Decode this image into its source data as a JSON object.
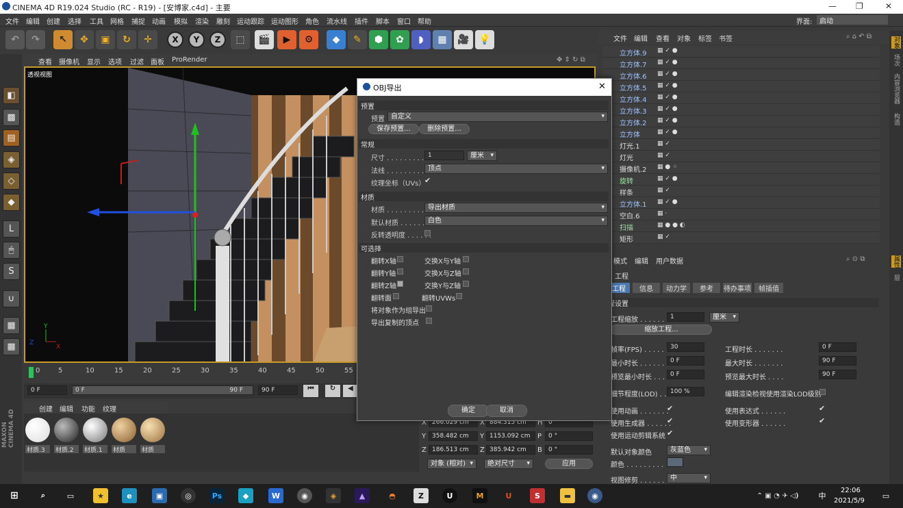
{
  "window": {
    "title": "CINEMA 4D R19.024 Studio (RC - R19) - [安博家.c4d] - 主要",
    "minimize": "—",
    "maximize": "❐",
    "close": "✕"
  },
  "menu": [
    "文件",
    "编辑",
    "创建",
    "选择",
    "工具",
    "网格",
    "捕捉",
    "动画",
    "模拟",
    "渲染",
    "雕刻",
    "运动跟踪",
    "运动图形",
    "角色",
    "流水线",
    "插件",
    "脚本",
    "窗口",
    "帮助"
  ],
  "layout": {
    "label": "界面:",
    "value": "启动"
  },
  "viewport": {
    "menu": [
      "查看",
      "摄像机",
      "显示",
      "选项",
      "过滤",
      "面板",
      "ProRender"
    ],
    "label": "透视视图"
  },
  "timeline": {
    "ticks": [
      "0",
      "5",
      "10",
      "15",
      "20",
      "25",
      "30",
      "35",
      "40",
      "45",
      "50",
      "55"
    ],
    "start": "0 F",
    "range_start": "0 F",
    "range_end": "90 F",
    "end": "90 F"
  },
  "materials": {
    "menu": [
      "创建",
      "编辑",
      "功能",
      "纹理"
    ],
    "items": [
      "材质.3",
      "材质.2",
      "材质.1",
      "材质",
      "材质"
    ]
  },
  "coords": {
    "x_pos": "266.029 cm",
    "y_pos": "358.482 cm",
    "z_pos": "186.513 cm",
    "x_size": "884.315 cm",
    "y_size": "1153.092 cm",
    "z_size": "385.942 cm",
    "h": "0 °",
    "p": "0 °",
    "b": "0 °",
    "mode": "对象 (相对)",
    "size_mode": "绝对尺寸",
    "apply": "应用"
  },
  "objects": {
    "menu": [
      "文件",
      "编辑",
      "查看",
      "对象",
      "标签",
      "书签"
    ],
    "rows": [
      "立方体.9",
      "立方体.7",
      "立方体.6",
      "立方体.5",
      "立方体.4",
      "立方体.3",
      "立方体.2",
      "立方体",
      "灯光.1",
      "灯光",
      "摄像机.2",
      "旋转",
      "样条",
      "立方体.1",
      "空白.6",
      "扫描",
      "矩形"
    ]
  },
  "attributes": {
    "menu": [
      "模式",
      "编辑",
      "用户数据"
    ],
    "title": "工程",
    "tabs": [
      "工程设置",
      "信息",
      "动力学",
      "参考",
      "待办事项",
      "帧插值"
    ],
    "section": "工程设置",
    "scale_label": "工程缩放 . . . . . . .",
    "scale_value": "1",
    "scale_unit": "厘米",
    "scale_btn": "缩放工程...",
    "fps_label": "帧率(FPS) . . . . . . .",
    "fps": "30",
    "time_label": "工程时长 . . . . . . .",
    "time": "0 F",
    "min_label": "最小时长 . . . . . . .",
    "min": "0 F",
    "max_label": "最大时长 . . . . . . .",
    "max": "90 F",
    "pmin_label": "预览最小时长 . . . .",
    "pmin": "0 F",
    "pmax_label": "预览最大时长 . . . .",
    "pmax": "90 F",
    "lod_label": "细节程度(LOD) . . . .",
    "lod": "100 %",
    "lod_render": "编辑渲染检视使用渲染LOD级别",
    "use_anim": "使用动画 . . . . . . .",
    "use_expr": "使用表达式 . . . . . .",
    "use_gen": "使用生成器 . . . . . .",
    "use_deform": "使用变形器 . . . . . .",
    "use_mograph": "使用运动剪辑系统",
    "obj_color_label": "默认对象颜色",
    "obj_color": "灰蓝色",
    "color_label": "颜色 . . . . . . . . .",
    "view_clip": "视图修剪 . . . . . . .",
    "view_clip_val": "中"
  },
  "dialog": {
    "title": "OBJ导出",
    "close": "✕",
    "sec_preset": "预置",
    "preset_label": "预置",
    "preset_value": "自定义",
    "save_preset": "保存预置...",
    "delete_preset": "删除预置...",
    "sec_general": "常规",
    "size_label": "尺寸 . . . . . . . . .",
    "size_value": "1",
    "size_unit": "厘米",
    "normal_label": "法线 . . . . . . . . .",
    "normal_value": "顶点",
    "uv_label": "纹理坐标（UVs）",
    "sec_material": "材质",
    "mat_label": "材质 . . . . . . . . .",
    "mat_value": "导出材质",
    "defmat_label": "默认材质 . . . . . . .",
    "defmat_value": "白色",
    "flip_trans": "反转透明度 . . . . . .",
    "sec_optional": "可选择",
    "flip_x": "翻转X轴",
    "flip_y": "翻转Y轴",
    "flip_z": "翻转Z轴",
    "flip_face": "翻转面",
    "swap_xy": "交换X与Y轴",
    "swap_xz": "交换X与Z轴",
    "swap_yz": "交换Y与Z轴",
    "flip_uvw": "翻转UVWs",
    "as_group": "将对象作为组导出",
    "export_dup": "导出复制的顶点",
    "ok": "确定",
    "cancel": "取消"
  },
  "taskbar": {
    "time": "22:06",
    "date": "2021/5/9",
    "ime": "中"
  },
  "side_tabs": [
    "对象",
    "场次",
    "内容浏览器",
    "构造",
    "属性",
    "层"
  ],
  "maxon": "MAXON CINEMA 4D"
}
